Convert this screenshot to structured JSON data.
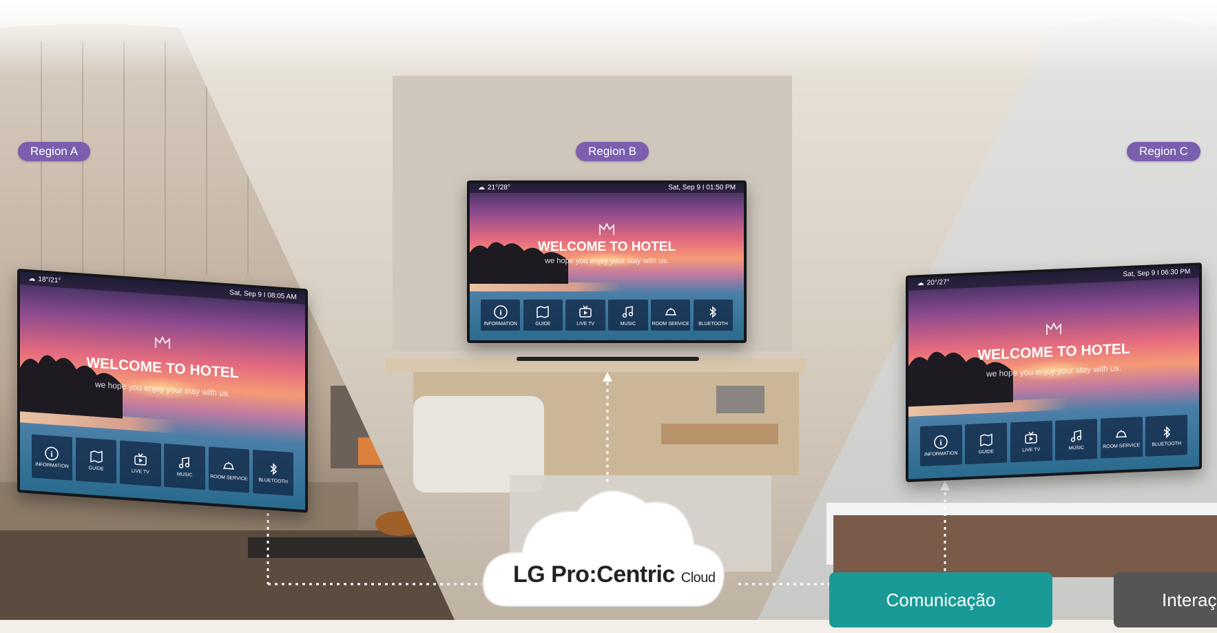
{
  "regions": {
    "a": {
      "label": "Region A"
    },
    "b": {
      "label": "Region B"
    },
    "c": {
      "label": "Region C"
    }
  },
  "tvs": {
    "a": {
      "weather": "18°/21°",
      "clock": "Sat, Sep 9 I 08:05 AM"
    },
    "b": {
      "weather": "21°/28°",
      "clock": "Sat, Sep 9 I 01:50 PM"
    },
    "c": {
      "weather": "20°/27°",
      "clock": "Sat, Sep 9 I 06:30 PM"
    }
  },
  "welcome": {
    "title": "WELCOME TO HOTEL",
    "subtitle": "we hope you enjoy your stay with us."
  },
  "menu": {
    "information": "INFORMATION",
    "guide": "GUIDE",
    "live_tv": "LIVE TV",
    "music": "MUSIC",
    "room_service": "ROOM SERVICE",
    "bluetooth": "BLUETOOTH"
  },
  "cloud": {
    "brand": "LG",
    "product": "Pro:Centric",
    "suffix": "Cloud"
  },
  "tabs": {
    "communication": "Comunicação",
    "interaction": "Interação"
  },
  "colors": {
    "region_badge": "#7b5fae",
    "tab_active": "#1a9a96",
    "tab_inactive": "#555555"
  }
}
